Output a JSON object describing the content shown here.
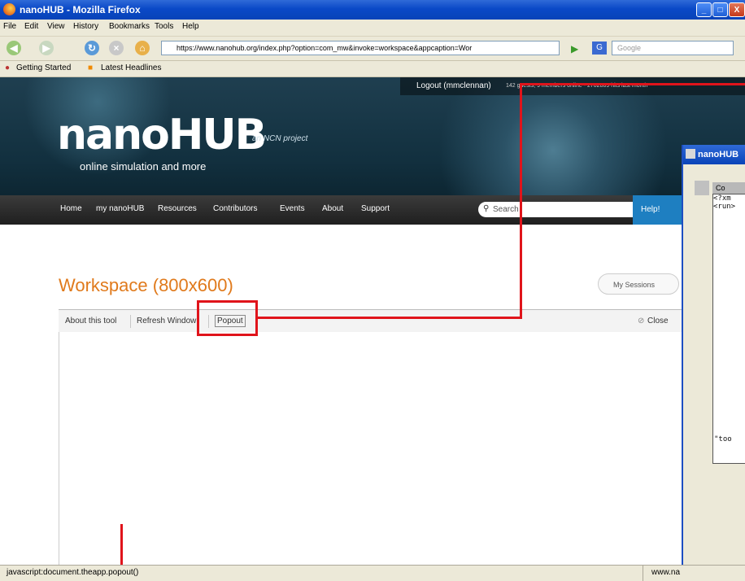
{
  "window": {
    "title": "nanoHUB - Mozilla Firefox",
    "buttons": {
      "minimize": "_",
      "maximize": "□",
      "close": "X"
    }
  },
  "menu": [
    "File",
    "Edit",
    "View",
    "History",
    "Bookmarks",
    "Tools",
    "Help"
  ],
  "nav": {
    "url": "https://www.nanohub.org/index.php?option=com_mw&invoke=workspace&appcaption=Wor",
    "search_placeholder": "Google",
    "icons": [
      "back-icon",
      "forward-icon",
      "reload-icon",
      "stop-icon",
      "home-icon"
    ]
  },
  "bookmarks": [
    "Getting Started",
    "Latest Headlines"
  ],
  "site": {
    "logout": "Logout (mmclennan)",
    "stats": "142 guests, 9 members online - 2702809 hits last month",
    "logo": "nanoHUB",
    "tagline": "online simulation and more",
    "ncn": "an NCN project",
    "nav_items": [
      "Home",
      "my nanoHUB",
      "Resources",
      "Contributors",
      "Events",
      "About",
      "Support"
    ],
    "search_placeholder": "Search",
    "help": "Help!"
  },
  "workspace": {
    "title": "Workspace (800x600)",
    "my_sessions": "My Sessions",
    "toolbar": {
      "about": "About this tool",
      "refresh": "Refresh Window",
      "popout": "Popout",
      "close": "Close"
    }
  },
  "app_window": {
    "title": "nanoHUB",
    "inner_title": "Co",
    "lines": [
      "<?xm",
      "<run>",
      "",
      "",
      "",
      "",
      "",
      "",
      "",
      "",
      "",
      "",
      "",
      "",
      "",
      "",
      "",
      "",
      "",
      "",
      "\"too"
    ]
  },
  "status": {
    "left": "javascript:document.theapp.popout()",
    "right": "www.na"
  },
  "colors": {
    "accent_orange": "#e07a1c",
    "annotation_red": "#e0141b",
    "xp_blue": "#0843b8"
  }
}
